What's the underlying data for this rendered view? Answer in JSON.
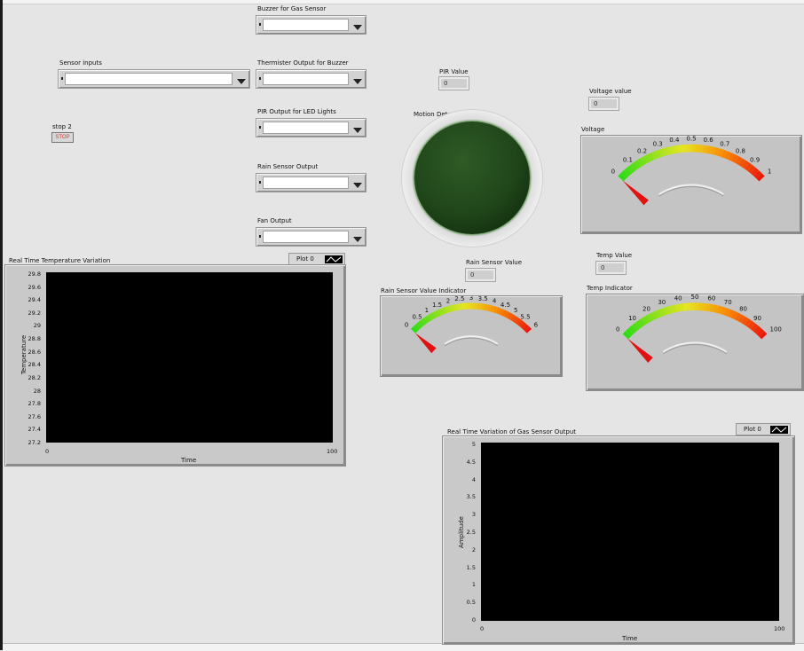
{
  "controls": {
    "sensor_inputs": {
      "label": "Sensor inputs",
      "value": ""
    },
    "stop": {
      "label": "stop 2",
      "button_text": "STOP"
    },
    "buzzer_gas": {
      "label": "Buzzer for Gas Sensor",
      "value": ""
    },
    "thermister_buzzer": {
      "label": "Thermister Output for Buzzer",
      "value": ""
    },
    "pir_led": {
      "label": "PIR Output for LED Lights",
      "value": ""
    },
    "rain_output": {
      "label": "Rain Sensor Output",
      "value": ""
    },
    "fan_output": {
      "label": "Fan Output",
      "value": ""
    }
  },
  "indicators": {
    "pir_value": {
      "label": "PIR Value",
      "value": "0"
    },
    "motion_detector": {
      "label": "Motion Detector",
      "state": "off",
      "color": "#1f4519"
    },
    "voltage_value": {
      "label": "Voltage value",
      "value": "0"
    },
    "rain_value": {
      "label": "Rain Sensor Value",
      "value": "0"
    },
    "temp_value": {
      "label": "Temp Value",
      "value": "0"
    }
  },
  "gauges": {
    "voltage": {
      "label": "Voltage",
      "ticks": [
        "0",
        "0.1",
        "0.2",
        "0.3",
        "0.4",
        "0.5",
        "0.6",
        "0.7",
        "0.8",
        "0.9",
        "1"
      ],
      "min": 0,
      "max": 1,
      "value": 0
    },
    "rain": {
      "label": "Rain Sensor Value Indicator",
      "ticks": [
        "0",
        "0.5",
        "1",
        "1.5",
        "2",
        "2.5",
        "3",
        "3.5",
        "4",
        "4.5",
        "5",
        "5.5",
        "6"
      ],
      "min": 0,
      "max": 6,
      "value": 0
    },
    "temp": {
      "label": "Temp Indicator",
      "ticks": [
        "0",
        "10",
        "20",
        "30",
        "40",
        "50",
        "60",
        "70",
        "80",
        "90",
        "100"
      ],
      "min": 0,
      "max": 100,
      "value": 0
    }
  },
  "charts": {
    "temperature": {
      "title": "Real Time Temperature Variation",
      "legend": "Plot 0",
      "xlabel": "Time",
      "ylabel": "Temperature",
      "xticks": [
        "0",
        "100"
      ],
      "yticks": [
        "29.8",
        "29.6",
        "29.4",
        "29.2",
        "29",
        "28.8",
        "28.6",
        "28.4",
        "28.2",
        "28",
        "27.8",
        "27.6",
        "27.4",
        "27.2"
      ]
    },
    "gas": {
      "title": "Real Time Variation of Gas Sensor Output",
      "legend": "Plot 0",
      "xlabel": "Time",
      "ylabel": "Amplitude",
      "xticks": [
        "0",
        "100"
      ],
      "yticks": [
        "5",
        "4.5",
        "4",
        "3.5",
        "3",
        "2.5",
        "2",
        "1.5",
        "1",
        "0.5",
        "0"
      ]
    }
  },
  "chart_data": [
    {
      "type": "line",
      "title": "Real Time Temperature Variation",
      "xlabel": "Time",
      "ylabel": "Temperature",
      "xlim": [
        0,
        100
      ],
      "ylim": [
        27.2,
        29.8
      ],
      "series": [],
      "legend": [
        "Plot 0"
      ],
      "legend_position": "top-right",
      "grid": false
    },
    {
      "type": "line",
      "title": "Real Time Variation of Gas Sensor Output",
      "xlabel": "Time",
      "ylabel": "Amplitude",
      "xlim": [
        0,
        100
      ],
      "ylim": [
        0,
        5
      ],
      "series": [],
      "legend": [
        "Plot 0"
      ],
      "legend_position": "top-right",
      "grid": false
    }
  ]
}
